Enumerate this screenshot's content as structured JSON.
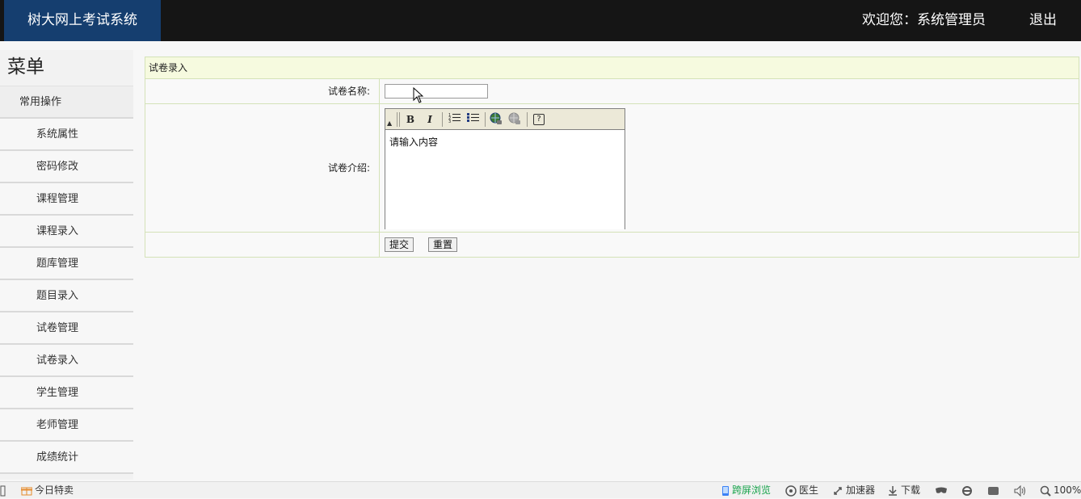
{
  "header": {
    "brand": "树大网上考试系统",
    "welcome": "欢迎您：系统管理员",
    "logout": "退出"
  },
  "sidebar": {
    "title": "菜单",
    "group": "常用操作",
    "items": [
      {
        "label": "系统属性"
      },
      {
        "label": "密码修改"
      },
      {
        "label": "课程管理"
      },
      {
        "label": "课程录入"
      },
      {
        "label": "题库管理"
      },
      {
        "label": "题目录入"
      },
      {
        "label": "试卷管理"
      },
      {
        "label": "试卷录入"
      },
      {
        "label": "学生管理"
      },
      {
        "label": "老师管理"
      },
      {
        "label": "成绩统计"
      }
    ]
  },
  "form": {
    "title": "试卷录入",
    "name_label": "试卷名称:",
    "name_value": "",
    "intro_label": "试卷介绍:",
    "editor_content": "请输入内容",
    "submit": "提交",
    "reset": "重置"
  },
  "statusbar": {
    "left": "今日特卖",
    "cross_screen": "跨屏浏览",
    "doctor": "医生",
    "accelerator": "加速器",
    "download": "下载",
    "zoom": "100%"
  },
  "colors": {
    "header_bg": "#151515",
    "brand_bg": "#153e6f",
    "form_border": "#d4e2b8",
    "form_title_bg": "#f6fadf"
  }
}
